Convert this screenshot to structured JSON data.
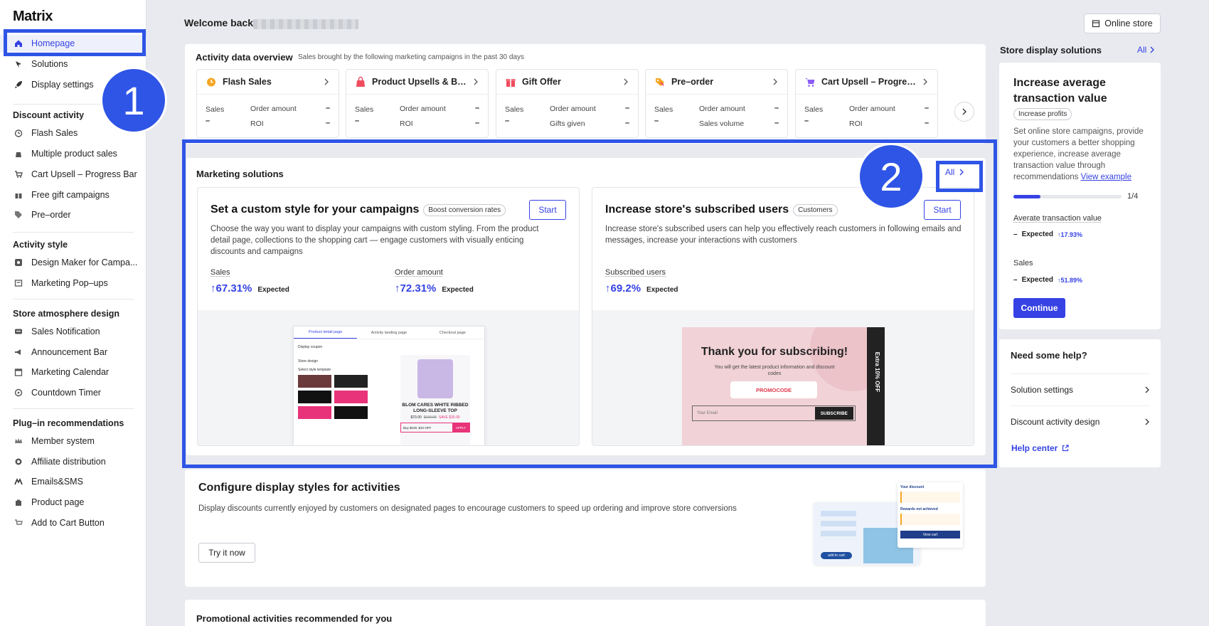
{
  "sidebar": {
    "logo": "Matrix",
    "top_items": [
      {
        "label": "Homepage",
        "icon": "home-icon"
      },
      {
        "label": "Solutions",
        "icon": "bulb-icon"
      },
      {
        "label": "Display settings",
        "icon": "rocket-icon"
      }
    ],
    "groups": [
      {
        "title": "Discount activity",
        "items": [
          "Flash Sales",
          "Multiple product sales",
          "Cart Upsell – Progress Bar",
          "Free gift campaigns",
          "Pre–order"
        ]
      },
      {
        "title": "Activity style",
        "items": [
          "Design Maker for Campa...",
          "Marketing Pop–ups"
        ]
      },
      {
        "title": "Store atmosphere design",
        "items": [
          "Sales Notification",
          "Announcement Bar",
          "Marketing Calendar",
          "Countdown Timer"
        ]
      },
      {
        "title": "Plug–in recommendations",
        "items": [
          "Member system",
          "Affiliate distribution",
          "Emails&SMS",
          "Product page",
          "Add to Cart Button"
        ]
      }
    ]
  },
  "annotations": {
    "badge1": "1",
    "badge2": "2"
  },
  "header": {
    "welcome": "Welcome back,",
    "online_store": "Online store"
  },
  "activity": {
    "title": "Activity data overview",
    "subtitle": "Sales brought by the following marketing campaigns in the past 30 days",
    "cards": [
      {
        "name": "Flash Sales",
        "l1": "Sales",
        "l2": "Order amount",
        "l3": "ROI",
        "v1": "–",
        "v2": "–",
        "v3": "–"
      },
      {
        "name": "Product Upsells & Bun...",
        "l1": "Sales",
        "l2": "Order amount",
        "l3": "ROI",
        "v1": "–",
        "v2": "–",
        "v3": "–"
      },
      {
        "name": "Gift Offer",
        "l1": "Sales",
        "l2": "Order amount",
        "l3": "Gifts given",
        "v1": "–",
        "v2": "–",
        "v3": "–"
      },
      {
        "name": "Pre–order",
        "l1": "Sales",
        "l2": "Order amount",
        "l3": "Sales volume",
        "v1": "–",
        "v2": "–",
        "v3": "–"
      },
      {
        "name": "Cart Upsell – Progress ...",
        "l1": "Sales",
        "l2": "Order amount",
        "l3": "ROI",
        "v1": "–",
        "v2": "–",
        "v3": "–"
      }
    ]
  },
  "marketing": {
    "title": "Marketing solutions",
    "all_label": "All",
    "cards": [
      {
        "title": "Set a custom style for your campaigns",
        "tag": "Boost conversion rates",
        "start": "Start",
        "desc": "Choose the way you want to display your campaigns with custom styling. From the product detail page, collections to the shopping cart — engage customers with visually enticing discounts and campaigns",
        "m1_label": "Sales",
        "m1_value": "↑67.31%",
        "m1_ex": "Expected",
        "m2_label": "Order amount",
        "m2_value": "↑72.31%",
        "m2_ex": "Expected",
        "illus": {
          "tab1": "Product detail page",
          "tab2": "Activity landing page",
          "tab3": "Checkout page",
          "coupon": "Display coupon",
          "store_design": "Store design",
          "select_style": "Select style template",
          "product": "BLOM CARES WHITE RIBBED LONG-SLEEVE TOP",
          "price": "$70.00",
          "old_price": "$100.00",
          "save": "SAVE $30.00",
          "buy": "Buy $100, $10 OFF",
          "apply": "APPLY"
        }
      },
      {
        "title": "Increase store's subscribed users",
        "tag": "Customers",
        "start": "Start",
        "desc": "Increase store's subscribed users can help you effectively reach customers in following emails and messages, increase your interactions with customers",
        "m1_label": "Subscribed users",
        "m1_value": "↑69.2%",
        "m1_ex": "Expected",
        "illus": {
          "heading": "Thank you for subscribing!",
          "sub": "You will get the latest product information and discount codes",
          "code": "PROMOCODE",
          "email_ph": "Your Email",
          "subscribe": "SUBSCRIBE",
          "side": "Extra 10% OFF"
        }
      }
    ]
  },
  "configure": {
    "title": "Configure display styles for activities",
    "desc": "Display discounts currently enjoyed by customers on designated pages to encourage customers to speed up ordering and improve store conversions",
    "button": "Try it now",
    "illus": {
      "your_discount": "Your discount",
      "rewards": "Rewards not achieved",
      "view_cart": "View cart",
      "add_to_cart": "add to cart"
    }
  },
  "promotional": {
    "title": "Promotional activities recommended for you"
  },
  "store_display": {
    "title": "Store display solutions",
    "all_label": "All",
    "card_title": "Increase average transaction value",
    "tag": "Increase profits",
    "desc": "Set online store campaigns, provide your customers a better shopping experience, increase average transaction value through recommendations",
    "link": "View example",
    "progress_label": "1/4",
    "progress_fraction": 0.25,
    "m1_label": "Averate transaction value",
    "m1_dash": "–",
    "m1_ex": "Expected",
    "m1_val": "↑17.93%",
    "m2_label": "Sales",
    "m2_dash": "–",
    "m2_ex": "Expected",
    "m2_val": "↑51.89%",
    "button": "Continue"
  },
  "help": {
    "title": "Need some help?",
    "items": [
      "Solution settings",
      "Discount activity design"
    ],
    "help_center": "Help center"
  },
  "colors": {
    "accent": "#3642e4",
    "annotation": "#2f55e6",
    "bg": "#e8eaef"
  }
}
